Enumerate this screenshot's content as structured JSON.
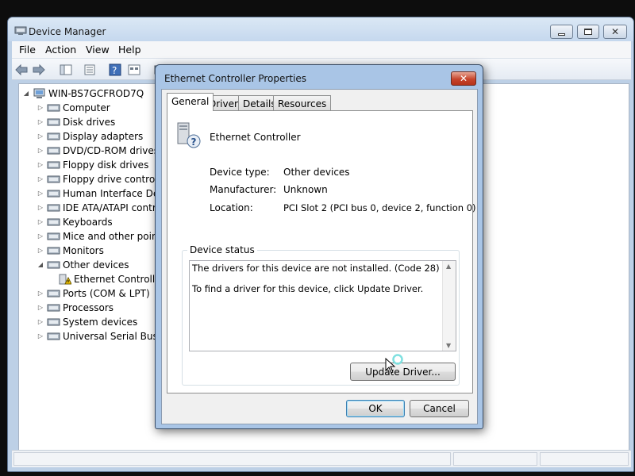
{
  "window": {
    "title": "Device Manager"
  },
  "menu": [
    "File",
    "Action",
    "View",
    "Help"
  ],
  "tree": {
    "root": "WIN-BS7GCFROD7Q",
    "items": [
      {
        "label": "Computer",
        "icon": "computer-icon"
      },
      {
        "label": "Disk drives",
        "icon": "disk-drive-icon"
      },
      {
        "label": "Display adapters",
        "icon": "display-adapter-icon"
      },
      {
        "label": "DVD/CD-ROM drives",
        "icon": "dvd-drive-icon"
      },
      {
        "label": "Floppy disk drives",
        "icon": "floppy-disk-icon"
      },
      {
        "label": "Floppy drive controlle",
        "icon": "floppy-controller-icon"
      },
      {
        "label": "Human Interface Devi",
        "icon": "hid-icon"
      },
      {
        "label": "IDE ATA/ATAPI contro",
        "icon": "ide-controller-icon"
      },
      {
        "label": "Keyboards",
        "icon": "keyboard-icon"
      },
      {
        "label": "Mice and other pointi",
        "icon": "mouse-icon"
      },
      {
        "label": "Monitors",
        "icon": "monitor-icon"
      },
      {
        "label": "Other devices",
        "icon": "unknown-device-icon"
      },
      {
        "label": "Ethernet Controlle",
        "icon": "warning-device-icon"
      },
      {
        "label": "Ports (COM & LPT)",
        "icon": "port-icon"
      },
      {
        "label": "Processors",
        "icon": "processor-icon"
      },
      {
        "label": "System devices",
        "icon": "system-device-icon"
      },
      {
        "label": "Universal Serial Bus co",
        "icon": "usb-icon"
      }
    ]
  },
  "dialog": {
    "title": "Ethernet Controller Properties",
    "tabs": [
      "General",
      "Driver",
      "Details",
      "Resources"
    ],
    "active_tab": "General",
    "device_name": "Ethernet Controller",
    "props": {
      "type_label": "Device type:",
      "type_value": "Other devices",
      "mfr_label": "Manufacturer:",
      "mfr_value": "Unknown",
      "loc_label": "Location:",
      "loc_value": "PCI Slot 2 (PCI bus 0, device 2, function 0)"
    },
    "status_title": "Device status",
    "status_line1": "The drivers for this device are not installed. (Code 28)",
    "status_line2": "To find a driver for this device, click Update Driver.",
    "update_button": "Update Driver...",
    "ok_button": "OK",
    "cancel_button": "Cancel"
  },
  "colors": {
    "title_bg": "#c5d8ee",
    "dialog_frame": "#a9c5e6",
    "close_red": "#c7452c",
    "warning": "#f2c200"
  }
}
